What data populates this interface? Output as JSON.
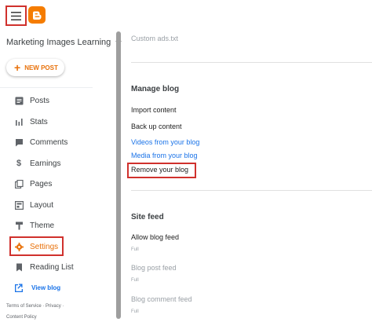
{
  "topbar": {
    "menu_icon": "hamburger-icon",
    "logo_icon": "blogger-logo-icon",
    "logo_color": "#f57c00"
  },
  "sidebar": {
    "blog_name": "Marketing Images Learning",
    "new_post_label": "NEW POST",
    "items": [
      {
        "label": "Posts",
        "icon": "posts-icon"
      },
      {
        "label": "Stats",
        "icon": "stats-icon"
      },
      {
        "label": "Comments",
        "icon": "comments-icon"
      },
      {
        "label": "Earnings",
        "icon": "dollar-icon"
      },
      {
        "label": "Pages",
        "icon": "pages-icon"
      },
      {
        "label": "Layout",
        "icon": "layout-icon"
      },
      {
        "label": "Theme",
        "icon": "theme-icon"
      },
      {
        "label": "Settings",
        "icon": "gear-icon",
        "active": true
      },
      {
        "label": "Reading List",
        "icon": "bookmark-icon"
      }
    ],
    "view_blog_label": "View blog",
    "footer": {
      "terms": "Terms of Service",
      "sep": " · ",
      "privacy": "Privacy",
      "sep2": " ·",
      "content_policy": "Content Policy"
    }
  },
  "main": {
    "custom_ads": "Custom ads.txt",
    "manage_blog": {
      "title": "Manage blog",
      "import": "Import content",
      "backup": "Back up content",
      "videos": "Videos from your blog",
      "media": "Media from your blog",
      "remove": "Remove your blog"
    },
    "site_feed": {
      "title": "Site feed",
      "allow_label": "Allow blog feed",
      "allow_value": "Full",
      "post_label": "Blog post feed",
      "post_value": "Full",
      "comment_label": "Blog comment feed",
      "comment_value": "Full"
    }
  },
  "colors": {
    "accent": "#e8710a",
    "link": "#1a73e8",
    "highlight": "#d0312d"
  }
}
